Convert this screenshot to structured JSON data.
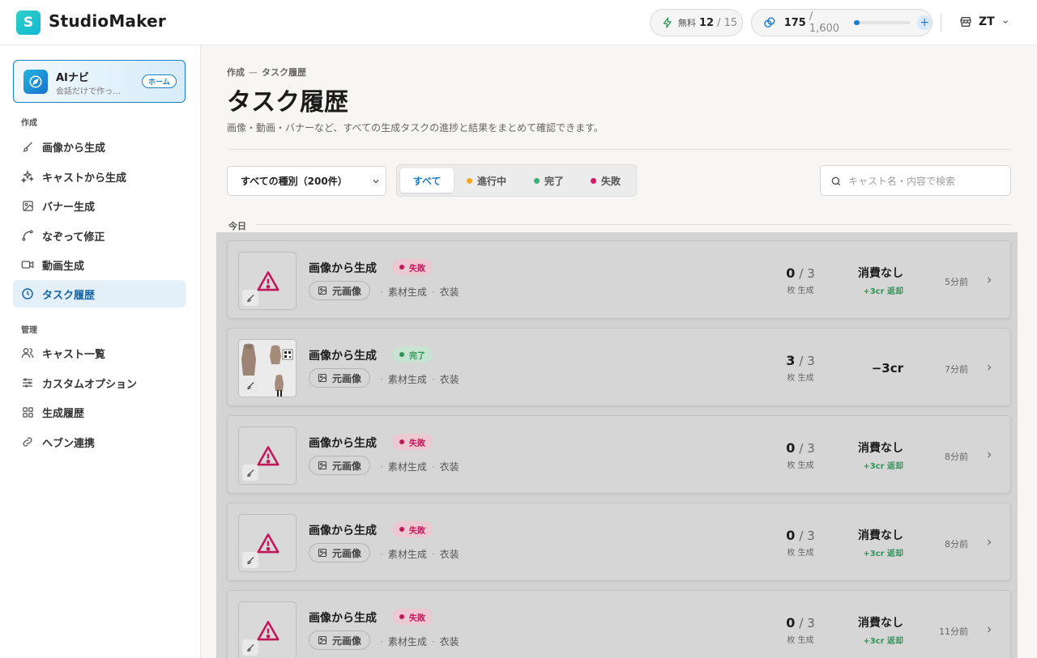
{
  "header": {
    "logo_letter": "S",
    "app_name": "StudioMaker",
    "free_label": "無料",
    "free_used": "12",
    "free_total": "/ 15",
    "credits": "175",
    "credits_total": "/ 1,600",
    "credits_fraction": 0.109,
    "plus": "+",
    "user_initials": "ZT"
  },
  "sidebar": {
    "ainavi_title": "AIナビ",
    "ainavi_subtitle": "会話だけで作っ…",
    "home_badge": "ホーム",
    "section_create": "作成",
    "section_manage": "管理",
    "items": [
      {
        "label": "画像から生成",
        "icon": "brush-icon"
      },
      {
        "label": "キャストから生成",
        "icon": "sparkle-icon"
      },
      {
        "label": "バナー生成",
        "icon": "image-icon"
      },
      {
        "label": "なぞって修正",
        "icon": "trace-icon"
      },
      {
        "label": "動画生成",
        "icon": "video-icon"
      },
      {
        "label": "タスク履歴",
        "icon": "clock-icon",
        "active": true
      },
      {
        "label": "キャスト一覧",
        "icon": "users-icon"
      },
      {
        "label": "カスタムオプション",
        "icon": "sliders-icon"
      },
      {
        "label": "生成履歴",
        "icon": "grid-icon"
      },
      {
        "label": "ヘブン連携",
        "icon": "link-icon"
      }
    ]
  },
  "main": {
    "breadcrumb_parent": "作成",
    "breadcrumb_sep": "—",
    "breadcrumb_current": "タスク履歴",
    "title": "タスク履歴",
    "description": "画像・動画・バナーなど、すべての生成タスクの進捗と結果をまとめて確認できます。",
    "type_select": "すべての種別（200件）",
    "filters": {
      "all": "すべて",
      "running": "進行中",
      "done": "完了",
      "failed": "失敗"
    },
    "search_placeholder": "キャスト名・内容で検索",
    "date_group": "今日"
  },
  "colors": {
    "accent": "#1e7fc9",
    "running": "#f5a623",
    "done": "#3bb273",
    "failed": "#d81b60"
  },
  "tasks": [
    {
      "title": "画像から生成",
      "status": "失敗",
      "status_type": "fail",
      "source": "元画像",
      "meta1": "素材生成",
      "meta2": "衣装",
      "count": "0",
      "count_total": "/ 3",
      "count_unit": "枚 生成",
      "cost": "消費なし",
      "refund": "+3cr 返却",
      "time": "5分前"
    },
    {
      "title": "画像から生成",
      "status": "完了",
      "status_type": "done",
      "source": "元画像",
      "meta1": "素材生成",
      "meta2": "衣装",
      "count": "3",
      "count_total": "/ 3",
      "count_unit": "枚 生成",
      "cost": "−3cr",
      "refund": "",
      "time": "7分前"
    },
    {
      "title": "画像から生成",
      "status": "失敗",
      "status_type": "fail",
      "source": "元画像",
      "meta1": "素材生成",
      "meta2": "衣装",
      "count": "0",
      "count_total": "/ 3",
      "count_unit": "枚 生成",
      "cost": "消費なし",
      "refund": "+3cr 返却",
      "time": "8分前"
    },
    {
      "title": "画像から生成",
      "status": "失敗",
      "status_type": "fail",
      "source": "元画像",
      "meta1": "素材生成",
      "meta2": "衣装",
      "count": "0",
      "count_total": "/ 3",
      "count_unit": "枚 生成",
      "cost": "消費なし",
      "refund": "+3cr 返却",
      "time": "8分前"
    },
    {
      "title": "画像から生成",
      "status": "失敗",
      "status_type": "fail",
      "source": "元画像",
      "meta1": "素材生成",
      "meta2": "衣装",
      "count": "0",
      "count_total": "/ 3",
      "count_unit": "枚 生成",
      "cost": "消費なし",
      "refund": "+3cr 返却",
      "time": "11分前"
    }
  ]
}
